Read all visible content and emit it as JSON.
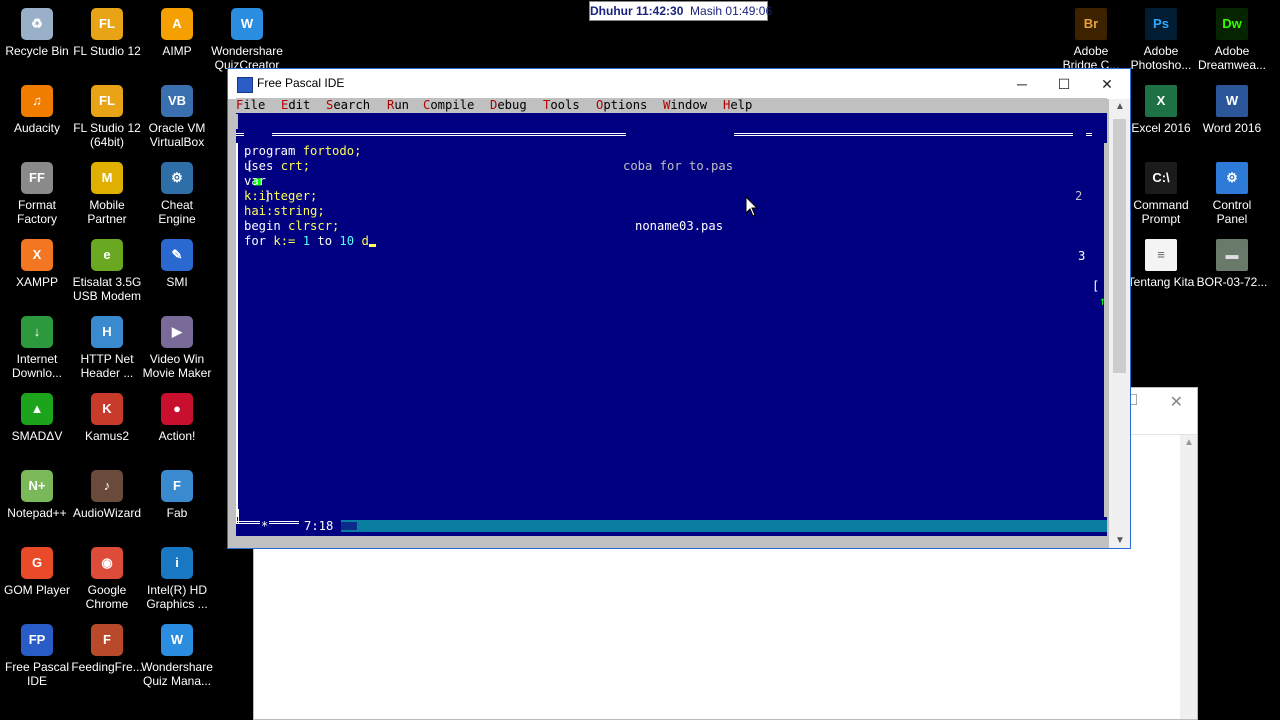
{
  "prayer_bar": {
    "label": "Dhuhur",
    "time": "11:42:30",
    "remaining_label": "Masih",
    "remaining": "01:49:06"
  },
  "desktop_left": [
    {
      "label": "Recycle Bin",
      "icon": "recycle-bin-icon",
      "color": "#9ab0c8",
      "glyph": "♻"
    },
    {
      "label": "FL Studio 12",
      "icon": "fl-studio-icon",
      "color": "#e8a317",
      "glyph": "FL"
    },
    {
      "label": "AIMP",
      "icon": "aimp-icon",
      "color": "#f5a000",
      "glyph": "A"
    },
    {
      "label": "Wondershare\nQuizCreator",
      "icon": "quizcreator-icon",
      "color": "#2a8de0",
      "glyph": "W"
    },
    {
      "label": "Audacity",
      "icon": "audacity-icon",
      "color": "#f07d00",
      "glyph": "♫"
    },
    {
      "label": "FL Studio 12\n(64bit)",
      "icon": "fl-studio-64-icon",
      "color": "#e8a317",
      "glyph": "FL"
    },
    {
      "label": "Oracle VM\nVirtualBox",
      "icon": "virtualbox-icon",
      "color": "#3a6fb0",
      "glyph": "VB"
    },
    {
      "label": "Format\nFactory",
      "icon": "format-factory-icon",
      "color": "#8a8a8a",
      "glyph": "FF"
    },
    {
      "label": "Mobile\nPartner",
      "icon": "mobile-partner-icon",
      "color": "#e0b000",
      "glyph": "M"
    },
    {
      "label": "Cheat Engine",
      "icon": "cheat-engine-icon",
      "color": "#2f6fa8",
      "glyph": "⚙"
    },
    {
      "label": "XAMPP",
      "icon": "xampp-icon",
      "color": "#f37623",
      "glyph": "X"
    },
    {
      "label": "Etisalat 3.5G\nUSB Modem",
      "icon": "etisalat-icon",
      "color": "#6aa821",
      "glyph": "e"
    },
    {
      "label": "SMI",
      "icon": "smi-icon",
      "color": "#2a6ad0",
      "glyph": "✎"
    },
    {
      "label": "Internet\nDownlo...",
      "icon": "idm-icon",
      "color": "#2c9a3c",
      "glyph": "↓"
    },
    {
      "label": "HTTP Net\nHeader ...",
      "icon": "http-header-icon",
      "color": "#3a8ad0",
      "glyph": "H"
    },
    {
      "label": "Video Win\nMovie Maker",
      "icon": "movie-maker-icon",
      "color": "#7a6a9a",
      "glyph": "▶"
    },
    {
      "label": "SMADΔV",
      "icon": "smadav-icon",
      "color": "#1ca51c",
      "glyph": "▲"
    },
    {
      "label": "Kamus2",
      "icon": "kamus-icon",
      "color": "#c83a2a",
      "glyph": "K"
    },
    {
      "label": "Action!",
      "icon": "action-icon",
      "color": "#c8102e",
      "glyph": "●"
    },
    {
      "label": "Notepad++",
      "icon": "notepadpp-icon",
      "color": "#7ab85a",
      "glyph": "N+"
    },
    {
      "label": "AudioWizard",
      "icon": "audiowizard-icon",
      "color": "#6a4a3a",
      "glyph": "♪"
    },
    {
      "label": "Fab",
      "icon": "fab-icon",
      "color": "#3a8ad0",
      "glyph": "F"
    },
    {
      "label": "GOM Player",
      "icon": "gom-player-icon",
      "color": "#e84a2a",
      "glyph": "G"
    },
    {
      "label": "Google\nChrome",
      "icon": "chrome-icon",
      "color": "#dd4b39",
      "glyph": "◉"
    },
    {
      "label": "Intel(R) HD\nGraphics ...",
      "icon": "intel-graphics-icon",
      "color": "#1a78c2",
      "glyph": "i"
    },
    {
      "label": "Free Pascal\nIDE",
      "icon": "free-pascal-icon",
      "color": "#2a5cc8",
      "glyph": "FP"
    },
    {
      "label": "FeedingFre...",
      "icon": "feedingfrenzy-icon",
      "color": "#b84a2a",
      "glyph": "F"
    },
    {
      "label": "Wondershare\nQuiz Mana...",
      "icon": "quiz-manager-icon",
      "color": "#2a8de0",
      "glyph": "W"
    }
  ],
  "desktop_right": [
    {
      "label": "Adobe\nBridge C...",
      "icon": "adobe-bridge-icon",
      "color": "#3d2200",
      "glyph": "Br",
      "fg": "#e6a23c"
    },
    {
      "label": "Adobe\nPhotosho...",
      "icon": "adobe-photoshop-icon",
      "color": "#001d34",
      "glyph": "Ps",
      "fg": "#31a8ff"
    },
    {
      "label": "Adobe\nDreamwea...",
      "icon": "adobe-dreamweaver-icon",
      "color": "#072401",
      "glyph": "Dw",
      "fg": "#35fa00"
    },
    {
      "label": "Excel 2016",
      "icon": "excel-icon",
      "color": "#1e7145",
      "glyph": "X",
      "fg": "#fff"
    },
    {
      "label": "Word 2016",
      "icon": "word-icon",
      "color": "#2b579a",
      "glyph": "W",
      "fg": "#fff"
    },
    {
      "label": "Command\nPrompt",
      "icon": "command-prompt-icon",
      "color": "#1b1b1b",
      "glyph": "C:\\",
      "fg": "#fff"
    },
    {
      "label": "Control\nPanel",
      "icon": "control-panel-icon",
      "color": "#2d7bd6",
      "glyph": "⚙",
      "fg": "#fff"
    },
    {
      "label": "Tentang Kita",
      "icon": "document-icon",
      "color": "#f4f4f4",
      "glyph": "≡",
      "fg": "#666"
    },
    {
      "label": "BOR-03-72...",
      "icon": "image-file-icon",
      "color": "#6a7a6a",
      "glyph": "▬",
      "fg": "#ddd"
    }
  ],
  "window": {
    "title": "Free Pascal IDE",
    "minimize": "─",
    "maximize": "☐",
    "close": "✕"
  },
  "menu": [
    {
      "hot": "F",
      "rest": "ile"
    },
    {
      "hot": "E",
      "rest": "dit"
    },
    {
      "hot": "S",
      "rest": "earch"
    },
    {
      "hot": "R",
      "rest": "un"
    },
    {
      "hot": "C",
      "rest": "ompile"
    },
    {
      "hot": "D",
      "rest": "ebug"
    },
    {
      "hot": "T",
      "rest": "ools"
    },
    {
      "hot": "O",
      "rest": "ptions"
    },
    {
      "hot": "W",
      "rest": "indow"
    },
    {
      "hot": "H",
      "rest": "elp"
    }
  ],
  "editor": {
    "back_window_title": "coba for to.pas",
    "back_window_number": "2",
    "front_window_title": "noname03.pas",
    "front_window_number": "3",
    "close_box": "■",
    "zoom_arrow": "↑",
    "modified_marker": "*",
    "cursor_position": "7:18",
    "code": [
      [
        {
          "t": "program ",
          "c": "kw"
        },
        {
          "t": "fortodo;",
          "c": "id"
        }
      ],
      [
        {
          "t": "uses ",
          "c": "kw"
        },
        {
          "t": "crt;",
          "c": "id"
        }
      ],
      [
        {
          "t": "var",
          "c": "kw"
        }
      ],
      [
        {
          "t": "k:integer;",
          "c": "id"
        }
      ],
      [
        {
          "t": "hai:string;",
          "c": "id"
        }
      ],
      [
        {
          "t": "begin ",
          "c": "kw"
        },
        {
          "t": "clrscr;",
          "c": "id"
        }
      ],
      [
        {
          "t": "for ",
          "c": "kw"
        },
        {
          "t": "k:= ",
          "c": "id"
        },
        {
          "t": "1",
          "c": "num"
        },
        {
          "t": " to ",
          "c": "kw"
        },
        {
          "t": "10",
          "c": "num"
        },
        {
          "t": " d",
          "c": "id"
        }
      ]
    ]
  }
}
